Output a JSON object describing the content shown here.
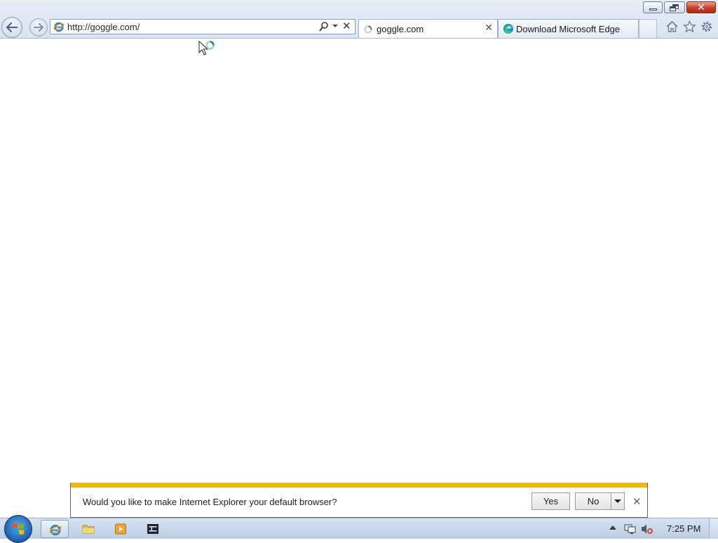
{
  "window": {
    "controls": [
      "minimize",
      "restore",
      "close"
    ]
  },
  "navigation": {
    "back_icon": "back-arrow-icon",
    "forward_icon": "forward-arrow-icon"
  },
  "address_bar": {
    "url": "http://goggle.com/",
    "site_icon": "internet-explorer-icon",
    "search_icon": "search-icon",
    "stop_icon": "close-icon"
  },
  "tabs": [
    {
      "title": "goggle.com",
      "icon": "loading-spinner-icon",
      "active": true,
      "close_icon": "close-icon"
    },
    {
      "title": "Download Microsoft Edge",
      "icon": "edge-icon",
      "active": false
    }
  ],
  "command_icons": [
    "home-icon",
    "star-icon",
    "gear-icon"
  ],
  "notification": {
    "message": "Would you like to make Internet Explorer your default browser?",
    "yes_label": "Yes",
    "no_label": "No",
    "accent_color": "#f1b80f"
  },
  "taskbar": {
    "items": [
      "internet-explorer-icon",
      "folder-icon",
      "media-player-icon",
      "terminal-icon"
    ],
    "clock": "7:25 PM"
  },
  "colors": {
    "chrome": "#dce7f4",
    "close_button": "#c6452e",
    "notification_stripe": "#f1b80f"
  }
}
